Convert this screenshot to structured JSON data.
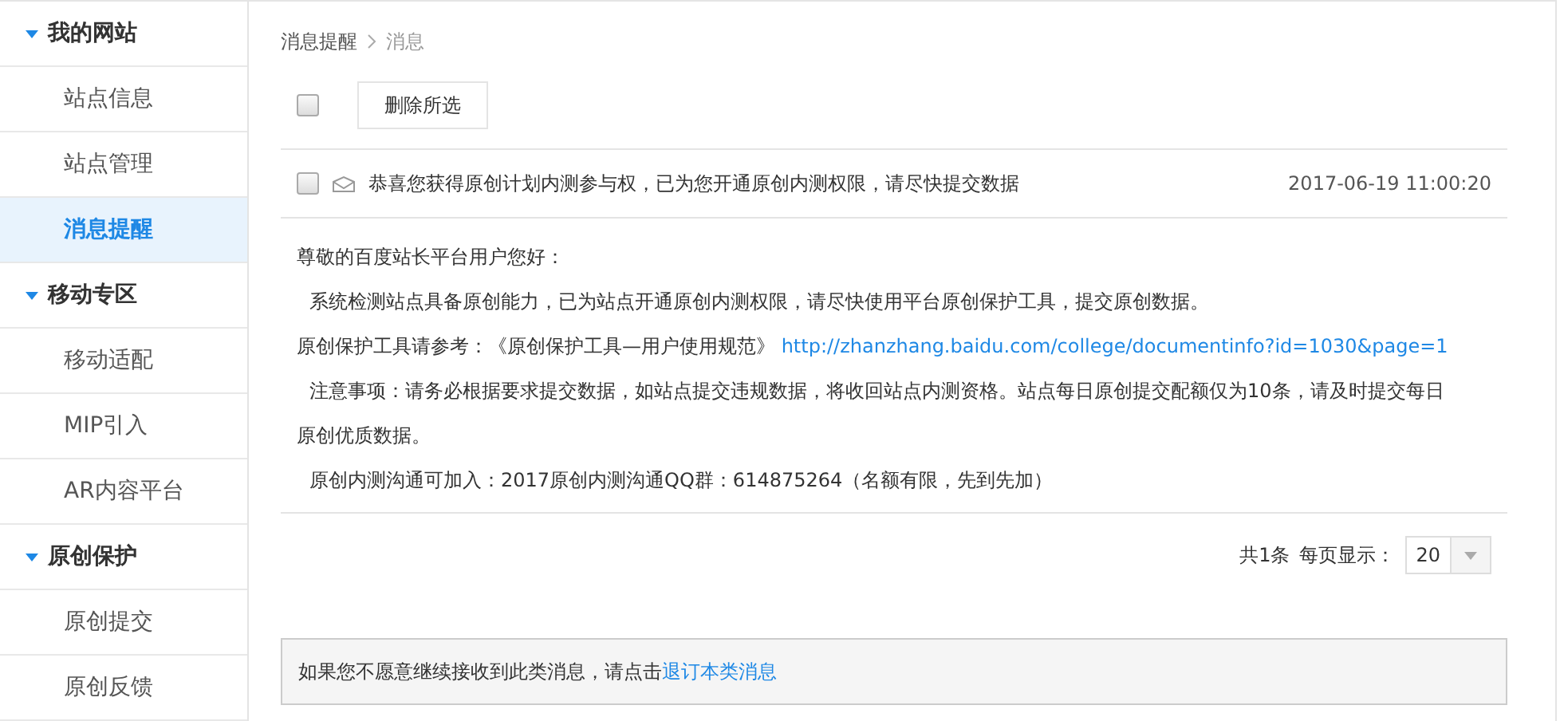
{
  "sidebar": {
    "groups": [
      {
        "title": "我的网站",
        "expanded": true,
        "items": [
          {
            "label": "站点信息",
            "selected": false
          },
          {
            "label": "站点管理",
            "selected": false
          },
          {
            "label": "消息提醒",
            "selected": true
          }
        ]
      },
      {
        "title": "移动专区",
        "expanded": true,
        "items": [
          {
            "label": "移动适配",
            "selected": false
          },
          {
            "label": "MIP引入",
            "selected": false
          },
          {
            "label": "AR内容平台",
            "selected": false
          }
        ]
      },
      {
        "title": "原创保护",
        "expanded": true,
        "items": [
          {
            "label": "原创提交",
            "selected": false
          },
          {
            "label": "原创反馈",
            "selected": false
          }
        ]
      }
    ]
  },
  "breadcrumb": [
    "消息提醒",
    "消息"
  ],
  "toolbar": {
    "select_all_checked": false,
    "delete_button": "删除所选"
  },
  "messages": [
    {
      "checked": false,
      "subject": "恭喜您获得原创计划内测参与权，已为您开通原创内测权限，请尽快提交数据",
      "time": "2017-06-19 11:00:20"
    }
  ],
  "message_body": [
    {
      "indented": false,
      "text": "尊敬的百度站长平台用户您好："
    },
    {
      "indented": true,
      "text": "系统检测站点具备原创能力，已为站点开通原创内测权限，请尽快使用平台原创保护工具，提交原创数据。"
    },
    {
      "indented": false,
      "text": "原创保护工具请参考：《原创保护工具—用户使用规范》",
      "link": "http://zhanzhang.baidu.com/college/documentinfo?id=1030&page=1"
    },
    {
      "indented": true,
      "text": "注意事项：请务必根据要求提交数据，如站点提交违规数据，将收回站点内测资格。站点每日原创提交配额仅为10条，请及时提交每日原创优质数据。"
    },
    {
      "indented": true,
      "text": "原创内测沟通可加入：2017原创内测沟通QQ群：614875264（名额有限，先到先加）"
    }
  ],
  "pagination": {
    "total": "共1条",
    "per_page_label": "每页显示：",
    "per_page": "20"
  },
  "footer": {
    "text": "如果您不愿意继续接收到此类消息，请点击",
    "link": "退订本类消息"
  }
}
